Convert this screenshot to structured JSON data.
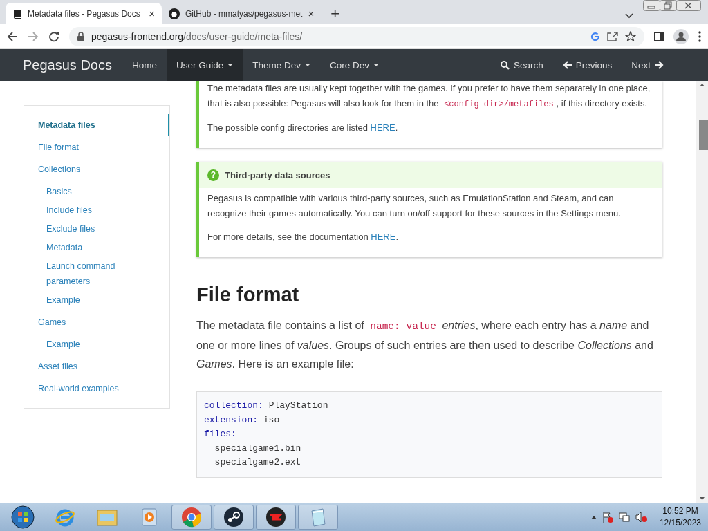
{
  "browser": {
    "tabs": [
      {
        "title": "Metadata files - Pegasus Docs",
        "selected": true,
        "close": "×"
      },
      {
        "title": "GitHub - mmatyas/pegasus-met",
        "selected": false,
        "close": "×"
      }
    ],
    "new_tab": "+",
    "url_domain": "pegasus-frontend.org",
    "url_path": "/docs/user-guide/meta-files/"
  },
  "navbar": {
    "brand": "Pegasus Docs",
    "items": [
      {
        "label": "Home",
        "dropdown": false,
        "selected": false
      },
      {
        "label": "User Guide",
        "dropdown": true,
        "selected": true
      },
      {
        "label": "Theme Dev",
        "dropdown": true,
        "selected": false
      },
      {
        "label": "Core Dev",
        "dropdown": true,
        "selected": false
      }
    ],
    "right": [
      {
        "label": "Search",
        "kind": "search"
      },
      {
        "label": "Previous",
        "kind": "prev"
      },
      {
        "label": "Next",
        "kind": "next"
      }
    ]
  },
  "sidebar": {
    "items": [
      {
        "label": "Metadata files",
        "selected": true
      },
      {
        "label": "File format",
        "selected": false
      },
      {
        "label": "Collections",
        "selected": false,
        "children": [
          {
            "label": "Basics",
            "selected": false
          },
          {
            "label": "Include files",
            "selected": false
          },
          {
            "label": "Exclude files",
            "selected": false
          },
          {
            "label": "Metadata",
            "selected": false
          },
          {
            "label": "Launch command parameters",
            "selected": false
          },
          {
            "label": "Example",
            "selected": false
          }
        ]
      },
      {
        "label": "Games",
        "selected": false,
        "children": [
          {
            "label": "Example",
            "selected": false
          }
        ]
      },
      {
        "label": "Asset files",
        "selected": false
      },
      {
        "label": "Real-world examples",
        "selected": false
      }
    ]
  },
  "content": {
    "callouts": [
      {
        "paragraphs": [
          [
            {
              "kind": "text",
              "text": "The metadata files are usually kept together with the games. If you prefer to have them separately in one place, that is also possible: Pegasus will also look for them in the "
            },
            {
              "kind": "code",
              "text": "<config dir>/metafiles"
            },
            {
              "kind": "text",
              "text": ", if this directory exists."
            }
          ],
          [
            {
              "kind": "text",
              "text": "The possible config directories are listed "
            },
            {
              "kind": "link",
              "text": "HERE"
            },
            {
              "kind": "text",
              "text": "."
            }
          ]
        ]
      },
      {
        "title": "Third-party data sources",
        "icon_glyph": "?",
        "paragraphs": [
          [
            {
              "kind": "text",
              "text": "Pegasus is compatible with various third-party sources, such as EmulationStation and Steam, and can recognize their games automatically. You can turn on/off support for these sources in the Settings menu."
            }
          ],
          [
            {
              "kind": "text",
              "text": "For more details, see the documentation "
            },
            {
              "kind": "link",
              "text": "HERE"
            },
            {
              "kind": "text",
              "text": "."
            }
          ]
        ]
      }
    ],
    "heading": "File format",
    "intro": [
      {
        "kind": "text",
        "text": "The metadata file contains a list of "
      },
      {
        "kind": "code",
        "text": "name: value"
      },
      {
        "kind": "text",
        "text": " *entries*, where each entry has a *name* and one or more lines of *values*. Groups of such entries are then used to describe *Collections* and *Games*. Here is an example file:"
      }
    ],
    "code": [
      {
        "kind": "entry",
        "key": "collection:",
        "value": "PlayStation"
      },
      {
        "kind": "entry",
        "key": "extension:",
        "value": "iso"
      },
      {
        "kind": "entry",
        "key": "files:"
      },
      {
        "kind": "item",
        "value": "specialgame1.bin"
      },
      {
        "kind": "item",
        "value": "specialgame2.ext"
      }
    ]
  },
  "taskbar": {
    "time": "10:52 PM",
    "date": "12/15/2023"
  }
}
